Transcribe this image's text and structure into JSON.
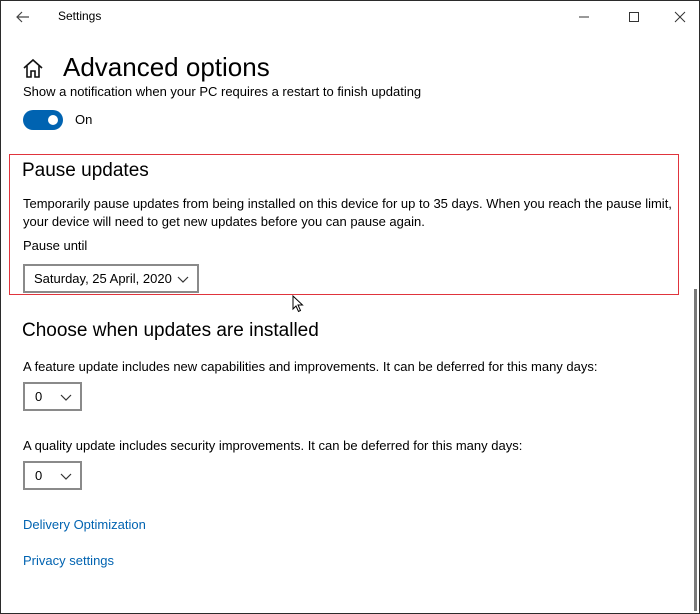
{
  "window": {
    "app_title": "Settings",
    "back_icon": "back-arrow-icon",
    "minimize_icon": "minimize-icon",
    "maximize_icon": "maximize-icon",
    "close_icon": "close-icon"
  },
  "header": {
    "home_icon": "home-icon",
    "title": "Advanced options"
  },
  "notification": {
    "text": "Show a notification when your PC requires a restart to finish updating",
    "toggle_state": "On",
    "toggle_on": true,
    "accent_color": "#0063b1"
  },
  "pause_updates": {
    "title": "Pause updates",
    "description": "Temporarily pause updates from being installed on this device for up to 35 days. When you reach the pause limit, your device will need to get new updates before you can pause again.",
    "pause_until_label": "Pause until",
    "pause_until_value": "Saturday, 25 April, 2020",
    "highlight_color": "#e0343c"
  },
  "choose_updates": {
    "title": "Choose when updates are installed",
    "feature_text": "A feature update includes new capabilities and improvements. It can be deferred for this many days:",
    "feature_value": "0",
    "quality_text": "A quality update includes security improvements. It can be deferred for this many days:",
    "quality_value": "0"
  },
  "links": {
    "delivery": "Delivery Optimization",
    "privacy": "Privacy settings"
  }
}
